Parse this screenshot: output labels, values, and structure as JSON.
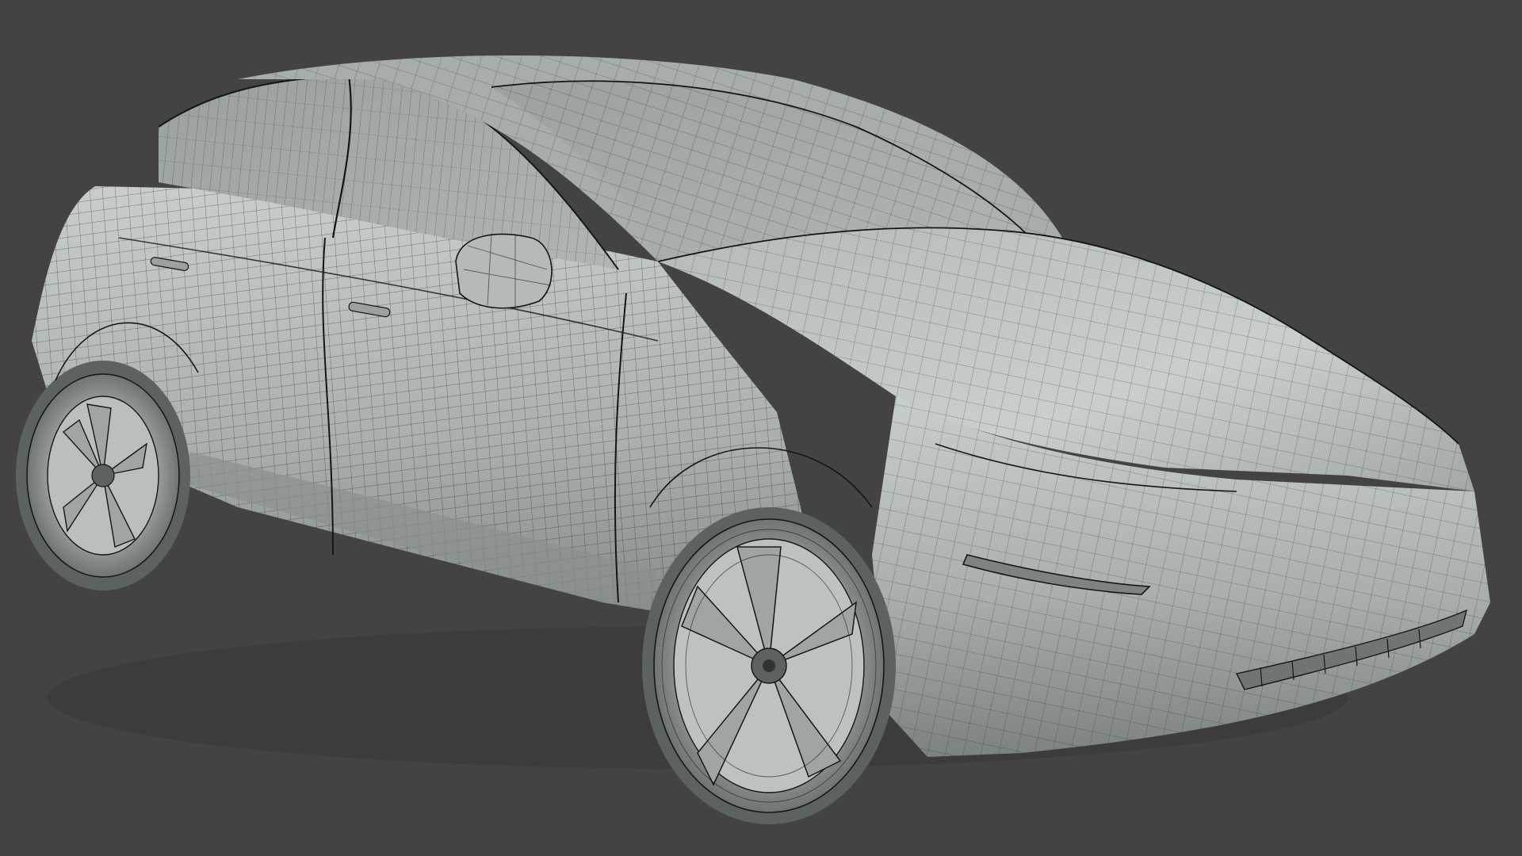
{
  "scene": {
    "background_color": "#434343",
    "body_color": "#a8aeae",
    "body_highlight": "#d4d8d8",
    "body_shadow": "#737979",
    "wire_color": "#1b1d1d",
    "glass_color": "#9ea4a4",
    "tire_color": "#8c9292",
    "rim_color": "#b9bfbf"
  }
}
